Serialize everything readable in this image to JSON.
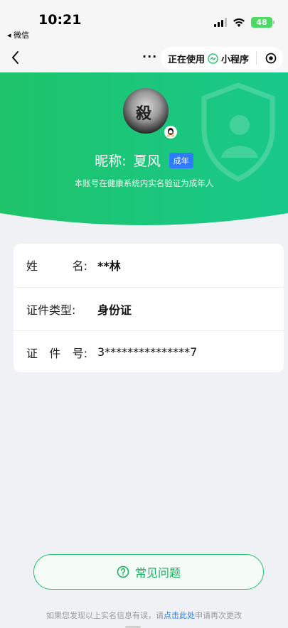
{
  "status_bar": {
    "time": "10:21",
    "back_app": "◂ 微信",
    "battery": "48"
  },
  "nav": {
    "more": "...",
    "in_use": "正在使用",
    "mini_program": "小程序"
  },
  "profile": {
    "nickname_label": "昵称:",
    "nickname": "夏风",
    "badge": "成年",
    "note": "本账号在健康系统内实名验证为成年人",
    "avatar_glyph": "殺"
  },
  "info": {
    "rows": [
      {
        "label_parts": [
          "姓",
          "名:"
        ],
        "value": "**林"
      },
      {
        "label_parts": [
          "证件类型:"
        ],
        "value": "身份证"
      },
      {
        "label_parts": [
          "证",
          "件",
          "号:"
        ],
        "value": "3***************7"
      }
    ]
  },
  "faq": {
    "label": "常见问题"
  },
  "footer": {
    "prefix": "如果您发现以上实名信息有误，请",
    "link": "点击此处",
    "suffix": "申请再次更改"
  },
  "colors": {
    "green_top": "#1ec36a",
    "green_bottom": "#19c98b",
    "badge_blue": "#2f7bff",
    "link_blue": "#2a7be0"
  },
  "icons": {
    "back": "chevron-left-icon",
    "mini_program": "mini-program-icon",
    "target": "target-icon",
    "faq": "question-circle-icon",
    "shield": "shield-icon"
  }
}
